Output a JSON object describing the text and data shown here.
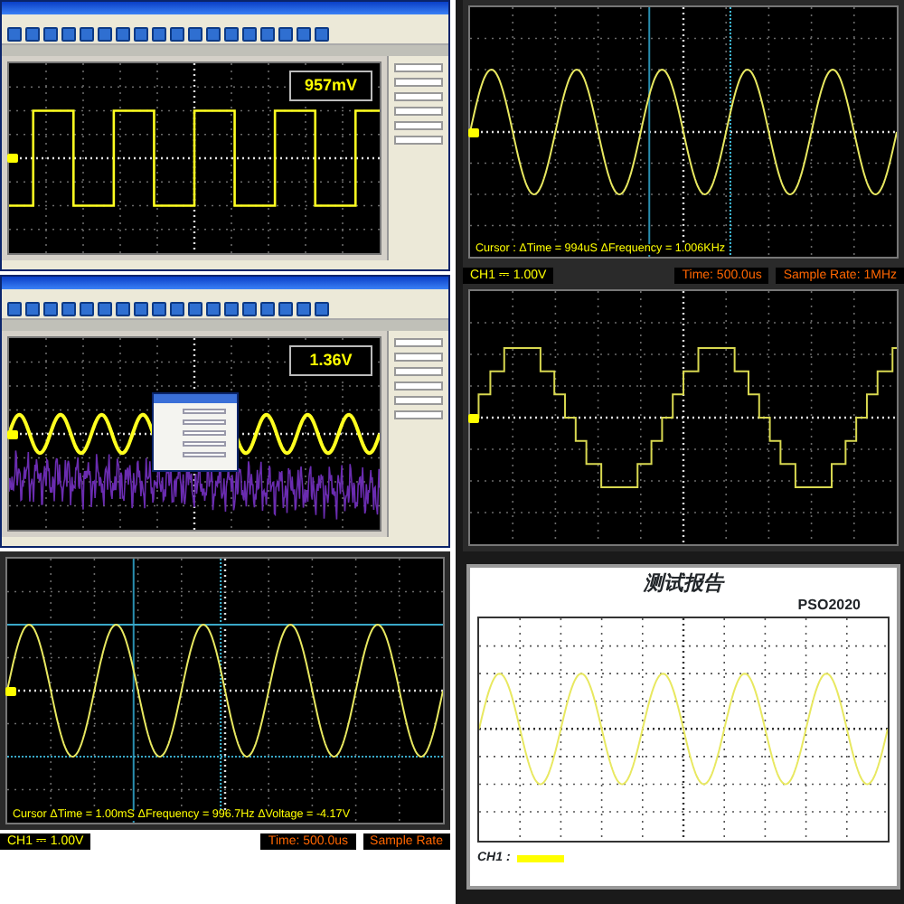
{
  "panels": [
    {
      "kind": "app_window",
      "trace": {
        "kind": "square"
      },
      "readout": "957mV"
    },
    {
      "kind": "scope_capture",
      "trace": {
        "kind": "sine"
      },
      "cursor_readout": "Cursor : ΔTime = 994uS ΔFrequency = 1.006KHz",
      "status": {
        "channel": "CH1 ⎓ 1.00V",
        "time": "Time: 500.0us",
        "sample_rate": "Sample Rate: 1MHz"
      }
    },
    {
      "kind": "app_window",
      "trace": {
        "kind": "sine_noise"
      },
      "readout": "1.36V",
      "dialog_open": true
    },
    {
      "kind": "scope_capture",
      "trace": {
        "kind": "staircase"
      }
    },
    {
      "kind": "scope_capture",
      "trace": {
        "kind": "sine"
      },
      "cursor_readout": "Cursor ΔTime = 1.00mS ΔFrequency = 996.7Hz ΔVoltage = -4.17V",
      "status": {
        "channel": "CH1 ⎓ 1.00V",
        "time": "Time: 500.0us",
        "sample_rate": "Sample Rate"
      }
    },
    {
      "kind": "report",
      "title": "测试报告",
      "model": "PSO2020",
      "trace": {
        "kind": "sine"
      },
      "channel": "CH1 :"
    }
  ]
}
